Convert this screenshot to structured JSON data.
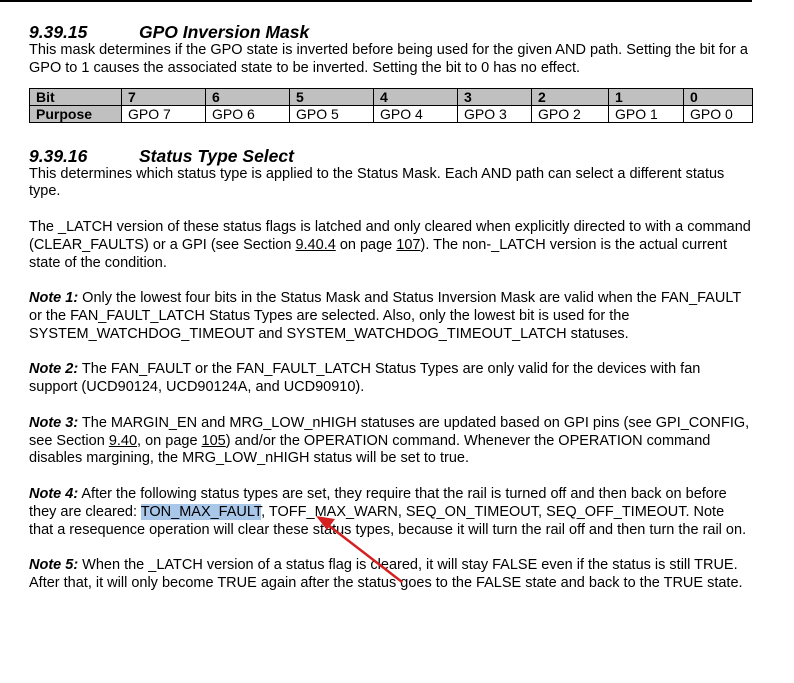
{
  "section1": {
    "number": "9.39.15",
    "title": "GPO Inversion Mask",
    "body": "This mask determines if the GPO state is inverted before being used for the given AND path.  Setting the bit for a GPO to 1 causes the associated state to be inverted.  Setting the bit to 0 has no effect."
  },
  "table": {
    "header_label": "Bit",
    "row_label": "Purpose",
    "bits": [
      "7",
      "6",
      "5",
      "4",
      "3",
      "2",
      "1",
      "0"
    ],
    "purposes": [
      "GPO 7",
      "GPO 6",
      "GPO 5",
      "GPO 4",
      "GPO 3",
      "GPO 2",
      "GPO 1",
      "GPO 0"
    ]
  },
  "section2": {
    "number": "9.39.16",
    "title": "Status Type Select",
    "intro": "This determines which status type is applied to the Status Mask.  Each AND path can select a different status type.",
    "latch_a": "The _LATCH version of these status flags is latched and only cleared when explicitly directed to with a command (CLEAR_FAULTS) or a GPI (see Section ",
    "latch_ref1": "9.40.4",
    "latch_b": " on page ",
    "latch_ref2": "107",
    "latch_c": ").  The non-_LATCH version is the actual current state of the condition.",
    "note1_label": "Note 1:",
    "note1": " Only the lowest four bits in the Status Mask and Status Inversion Mask are valid when the FAN_FAULT or the FAN_FAULT_LATCH Status Types are selected.  Also, only the lowest bit is used for the SYSTEM_WATCHDOG_TIMEOUT and SYSTEM_WATCHDOG_TIMEOUT_LATCH statuses.",
    "note2_label": "Note 2:",
    "note2": " The FAN_FAULT or the FAN_FAULT_LATCH Status Types are only valid for the devices with fan support (UCD90124, UCD90124A, and UCD90910).",
    "note3_label": "Note 3:",
    "note3_a": " The MARGIN_EN and MRG_LOW_nHIGH statuses are updated based on GPI pins (see GPI_CONFIG, see Section ",
    "note3_ref1": "9.40",
    "note3_b": ", on page ",
    "note3_ref2": "105",
    "note3_c": ") and/or the OPERATION command.  Whenever the OPERATION command disables margining, the MRG_LOW_nHIGH status will be set to true.",
    "note4_label": "Note 4:",
    "note4_a": " After the following status types are set, they require that the rail is turned off and then back on before they are cleared: ",
    "note4_highlight": "TON_MAX_FAULT",
    "note4_b": ", TOFF_MAX_WARN, SEQ_ON_TIMEOUT, SEQ_OFF_TIMEOUT.  Note that a resequence operation will clear these status types, because it will turn the rail off and then turn the rail on.",
    "note5_label": "Note 5:",
    "note5": " When the _LATCH version of a status flag is cleared, it will stay FALSE even if the status is still TRUE.  After that, it will only become TRUE again after the status goes to the FALSE state and back to the TRUE state."
  },
  "annotation": {
    "arrow_color": "#d42020",
    "highlight_color": "#a9c7e8"
  }
}
